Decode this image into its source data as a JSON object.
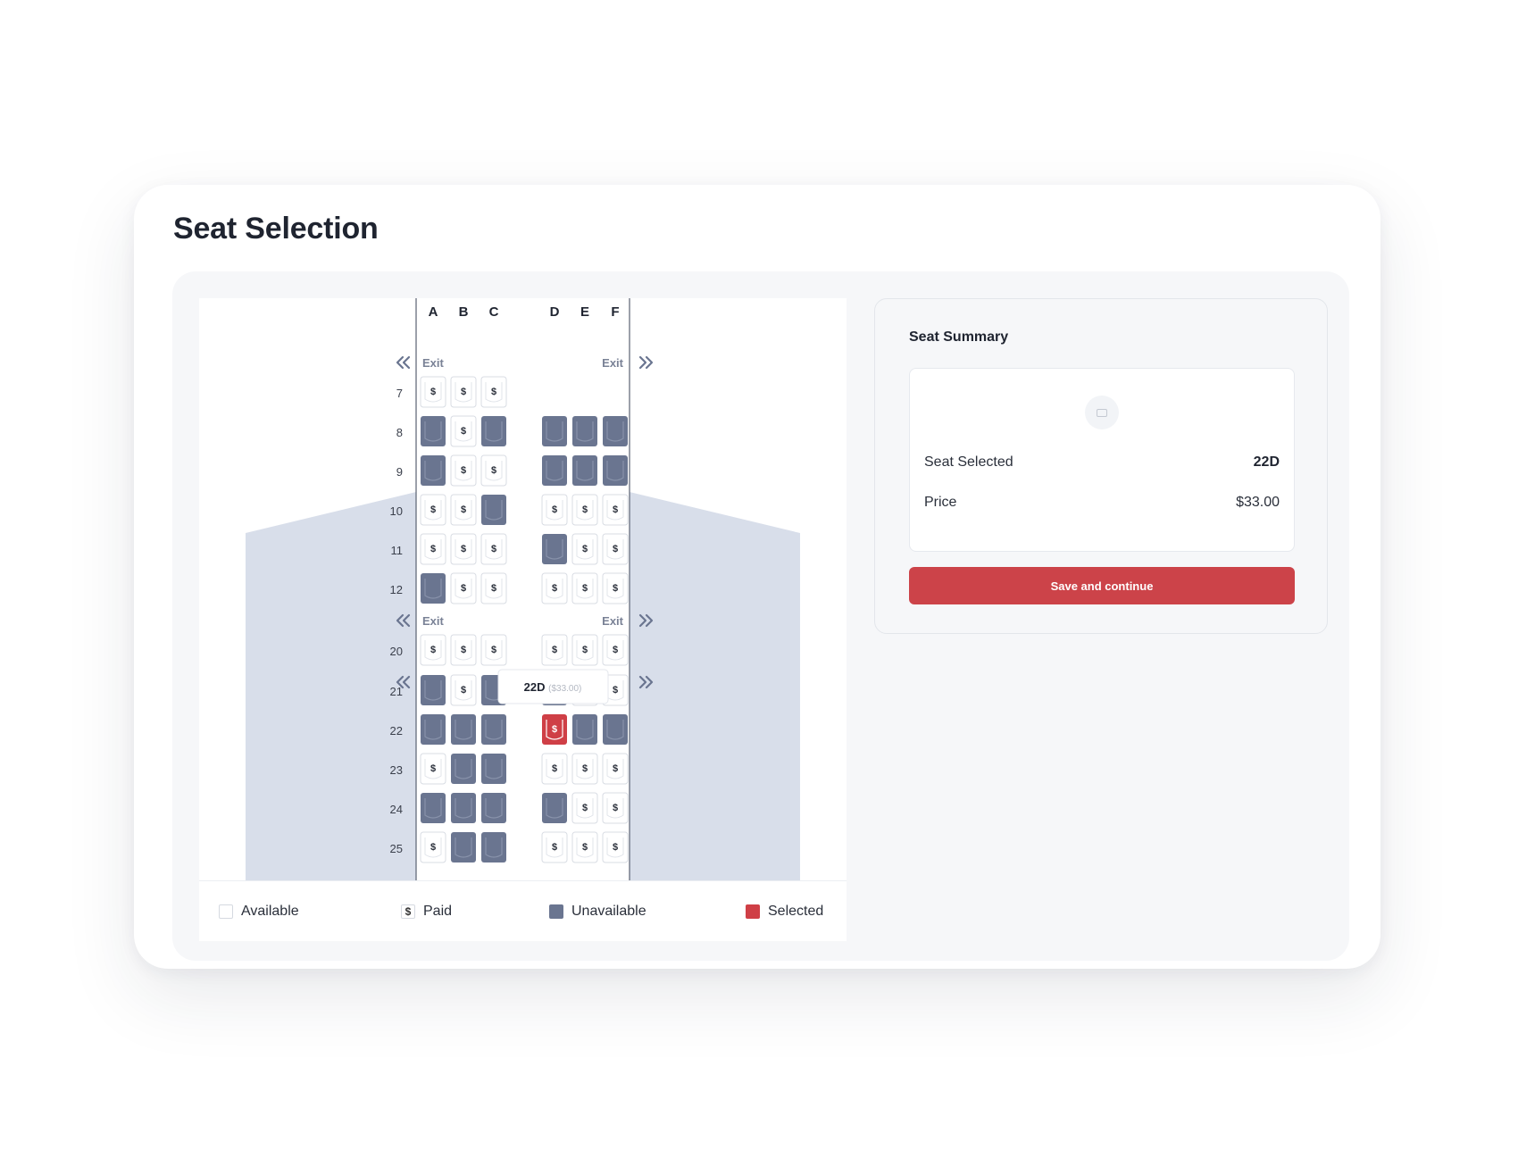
{
  "page": {
    "title": "Seat Selection"
  },
  "seat_map": {
    "columns": [
      "A",
      "B",
      "C",
      "D",
      "E",
      "F"
    ],
    "exit_label": "Exit",
    "paid_glyph": "$",
    "rows": [
      {
        "number": "7",
        "exit_before": true,
        "seats": [
          "paid",
          "paid",
          "paid",
          null,
          null,
          null
        ]
      },
      {
        "number": "8",
        "exit_before": false,
        "seats": [
          "unavailable",
          "paid",
          "unavailable",
          "unavailable",
          "unavailable",
          "unavailable"
        ]
      },
      {
        "number": "9",
        "exit_before": false,
        "seats": [
          "unavailable",
          "paid",
          "paid",
          "unavailable",
          "unavailable",
          "unavailable"
        ]
      },
      {
        "number": "10",
        "exit_before": false,
        "seats": [
          "paid",
          "paid",
          "unavailable",
          "paid",
          "paid",
          "paid"
        ]
      },
      {
        "number": "11",
        "exit_before": false,
        "seats": [
          "paid",
          "paid",
          "paid",
          "unavailable",
          "paid",
          "paid"
        ]
      },
      {
        "number": "12",
        "exit_before": false,
        "seats": [
          "unavailable",
          "paid",
          "paid",
          "paid",
          "paid",
          "paid"
        ]
      },
      {
        "number": "20",
        "exit_before": true,
        "seats": [
          "paid",
          "paid",
          "paid",
          "paid",
          "paid",
          "paid"
        ]
      },
      {
        "number": "21",
        "exit_before": true,
        "seats": [
          "unavailable",
          "paid",
          "unavailable",
          "unavailable",
          "paid",
          "paid"
        ]
      },
      {
        "number": "22",
        "exit_before": false,
        "seats": [
          "unavailable",
          "unavailable",
          "unavailable",
          "selected",
          "unavailable",
          "unavailable"
        ]
      },
      {
        "number": "23",
        "exit_before": false,
        "seats": [
          "paid",
          "unavailable",
          "unavailable",
          "paid",
          "paid",
          "paid"
        ]
      },
      {
        "number": "24",
        "exit_before": false,
        "seats": [
          "unavailable",
          "unavailable",
          "unavailable",
          "unavailable",
          "paid",
          "paid"
        ]
      },
      {
        "number": "25",
        "exit_before": false,
        "seats": [
          "paid",
          "unavailable",
          "unavailable",
          "paid",
          "paid",
          "paid"
        ]
      }
    ],
    "tooltip": {
      "seat": "22D",
      "price": "($33.00)"
    }
  },
  "legend": {
    "available": "Available",
    "paid_symbol": "$",
    "paid": "Paid",
    "unavailable": "Unavailable",
    "selected": "Selected"
  },
  "summary": {
    "title": "Seat Summary",
    "seat_label": "Seat Selected",
    "seat_value": "22D",
    "price_label": "Price",
    "price_value": "$33.00",
    "button_label": "Save and continue"
  },
  "colors": {
    "unavailable": "#6a7590",
    "selected": "#cf3f46",
    "wing": "#d8deea",
    "accent_button": "#cc4349"
  }
}
